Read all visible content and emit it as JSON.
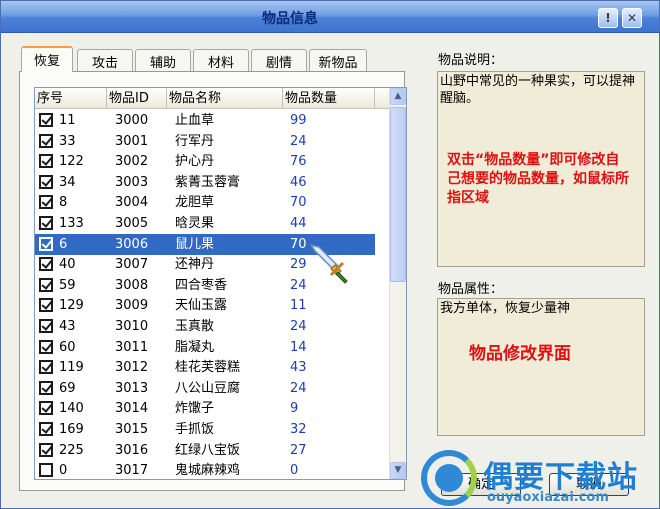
{
  "window": {
    "title": "物品信息",
    "help_btn": "!",
    "close_btn": "✕"
  },
  "tabs": [
    {
      "label": "恢复",
      "active": true
    },
    {
      "label": "攻击"
    },
    {
      "label": "辅助"
    },
    {
      "label": "材料"
    },
    {
      "label": "剧情"
    },
    {
      "label": "新物品"
    }
  ],
  "list": {
    "columns": [
      "序号",
      "物品ID",
      "物品名称",
      "物品数量"
    ],
    "rows": [
      {
        "checked": true,
        "seq": "11",
        "id": "3000",
        "name": "止血草",
        "qty": "99"
      },
      {
        "checked": true,
        "seq": "33",
        "id": "3001",
        "name": "行军丹",
        "qty": "24"
      },
      {
        "checked": true,
        "seq": "122",
        "id": "3002",
        "name": "护心丹",
        "qty": "76"
      },
      {
        "checked": true,
        "seq": "34",
        "id": "3003",
        "name": "紫菁玉蓉膏",
        "qty": "46"
      },
      {
        "checked": true,
        "seq": "8",
        "id": "3004",
        "name": "龙胆草",
        "qty": "70"
      },
      {
        "checked": true,
        "seq": "133",
        "id": "3005",
        "name": "晗灵果",
        "qty": "44"
      },
      {
        "checked": true,
        "seq": "6",
        "id": "3006",
        "name": "鼠儿果",
        "qty": "70",
        "selected": true
      },
      {
        "checked": true,
        "seq": "40",
        "id": "3007",
        "name": "还神丹",
        "qty": "29"
      },
      {
        "checked": true,
        "seq": "59",
        "id": "3008",
        "name": "四合枣香",
        "qty": "24"
      },
      {
        "checked": true,
        "seq": "129",
        "id": "3009",
        "name": "天仙玉露",
        "qty": "11"
      },
      {
        "checked": true,
        "seq": "43",
        "id": "3010",
        "name": "玉真散",
        "qty": "24"
      },
      {
        "checked": true,
        "seq": "60",
        "id": "3011",
        "name": "脂凝丸",
        "qty": "14"
      },
      {
        "checked": true,
        "seq": "119",
        "id": "3012",
        "name": "桂花芙蓉糕",
        "qty": "43"
      },
      {
        "checked": true,
        "seq": "69",
        "id": "3013",
        "name": "八公山豆腐",
        "qty": "24"
      },
      {
        "checked": true,
        "seq": "140",
        "id": "3014",
        "name": "炸馓子",
        "qty": "9"
      },
      {
        "checked": true,
        "seq": "169",
        "id": "3015",
        "name": "手抓饭",
        "qty": "32"
      },
      {
        "checked": true,
        "seq": "225",
        "id": "3016",
        "name": "红绿八宝饭",
        "qty": "27"
      },
      {
        "checked": false,
        "seq": "0",
        "id": "3017",
        "name": "鬼城麻辣鸡",
        "qty": "0"
      }
    ]
  },
  "description": {
    "label": "物品说明：",
    "text": "山野中常见的一种果实，可以提神醒脑。",
    "annotation": "双击“物品数量”即可修改自己想要的物品数量，如鼠标所指区域"
  },
  "attributes": {
    "label": "物品属性：",
    "text": "我方单体，恢复少量神",
    "annotation": "物品修改界面"
  },
  "buttons": {
    "ok": "确定",
    "cancel": "取消"
  },
  "watermark": {
    "text": "偶要下载站",
    "url": "ouyaoxiazai.com"
  },
  "colors": {
    "selection": "#316ac5",
    "annotation": "#e01010",
    "qty_text": "#1a3fb5"
  }
}
